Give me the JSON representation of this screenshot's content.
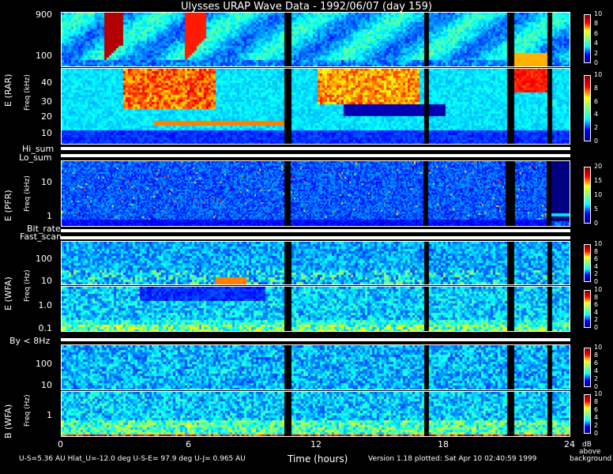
{
  "title": "Ulysses URAP Wave Data - 1992/06/07  (day 159)",
  "panels": {
    "rar_hi": {
      "ticks": [
        "900",
        "100"
      ]
    },
    "rar_lo": {
      "ticks": [
        "40",
        "30",
        "20",
        "10"
      ]
    },
    "rar_label": "E (RAR)",
    "rar_freq": "Freq (kHz)",
    "hi_sum": "Hi_sum",
    "lo_sum": "Lo_sum",
    "pfr": {
      "label": "E (PFR)",
      "freq": "Freq (kHz)",
      "ticks": [
        "10",
        "1"
      ]
    },
    "bit_rate": "Bit_rate",
    "fast_scan": "Fast_scan",
    "wfa_e1": {
      "ticks": [
        "100",
        "10"
      ]
    },
    "wfa_e2": {
      "ticks": [
        "1.0",
        "0.1"
      ]
    },
    "wfa_e_label": "E (WFA)",
    "wfa_e_freq": "Freq (Hz)",
    "by": "By < 8Hz",
    "wfa_b1": {
      "ticks": [
        "100",
        "10"
      ]
    },
    "wfa_b2": {
      "ticks": [
        "1"
      ]
    },
    "wfa_b_label": "B (WFA)",
    "wfa_b_freq": "Freq (Hz)"
  },
  "colorbars": {
    "rar_hi": [
      "10",
      "8",
      "6",
      "4",
      "2",
      "0"
    ],
    "rar_lo": [
      "10",
      "8",
      "6",
      "4",
      "2",
      "0"
    ],
    "pfr": [
      "20",
      "15",
      "10",
      "5",
      "0"
    ],
    "wfa1": [
      "10",
      "8",
      "6",
      "4",
      "2",
      "0"
    ],
    "wfa2": [
      "10",
      "8",
      "6",
      "4",
      "2",
      "0"
    ],
    "wfa3": [
      "10",
      "8",
      "6",
      "4",
      "2",
      "0"
    ],
    "wfa4": [
      "10",
      "8",
      "6",
      "4",
      "2",
      "0"
    ]
  },
  "xaxis": {
    "ticks": [
      "0",
      "6",
      "12",
      "18",
      "24"
    ],
    "label": "Time (hours)"
  },
  "footer": {
    "left": "U-S=5.36 AU  Hlat_U=-12.0 deg  U-S-E= 97.9 deg  U-J= 0.965 AU",
    "right": "Version 1.18 plotted: Sat Apr 10 02:40:59 1999"
  },
  "legend_units": {
    "l1": "dB",
    "l2": "above",
    "l3": "background"
  },
  "chart_data": {
    "type": "heatmap",
    "title": "Ulysses URAP Wave Data - 1992/06/07  (day 159)",
    "xlabel": "Time (hours)",
    "xlim": [
      0,
      24
    ],
    "x_ticks": [
      0,
      6,
      12,
      18,
      24
    ],
    "data_gaps_hours": [
      10.6,
      17.1,
      21.0,
      22.9
    ],
    "panels": [
      {
        "name": "E (RAR)",
        "ylabel": "Freq (kHz)",
        "y_ticks": [
          900,
          100
        ],
        "scale": "log",
        "colorbar_range": [
          0,
          10
        ]
      },
      {
        "name": "E (RAR)",
        "ylabel": "Freq (kHz)",
        "y_ticks": [
          40,
          30,
          20,
          10
        ],
        "scale": "linear",
        "colorbar_range": [
          0,
          10
        ]
      },
      {
        "name": "E (PFR)",
        "ylabel": "Freq (kHz)",
        "y_ticks": [
          10,
          1
        ],
        "scale": "log",
        "colorbar_range": [
          0,
          20
        ]
      },
      {
        "name": "E (WFA)",
        "ylabel": "Freq (Hz)",
        "y_ticks": [
          100,
          10
        ],
        "scale": "log",
        "colorbar_range": [
          0,
          10
        ]
      },
      {
        "name": "E (WFA)",
        "ylabel": "Freq (Hz)",
        "y_ticks": [
          1.0,
          0.1
        ],
        "scale": "log",
        "colorbar_range": [
          0,
          10
        ]
      },
      {
        "name": "B (WFA)",
        "ylabel": "Freq (Hz)",
        "y_ticks": [
          100,
          10
        ],
        "scale": "log",
        "colorbar_range": [
          0,
          10
        ]
      },
      {
        "name": "B (WFA)",
        "ylabel": "Freq (Hz)",
        "y_ticks": [
          1
        ],
        "scale": "log",
        "colorbar_range": [
          0,
          10
        ]
      }
    ],
    "colorbar_unit": "dB above background"
  }
}
